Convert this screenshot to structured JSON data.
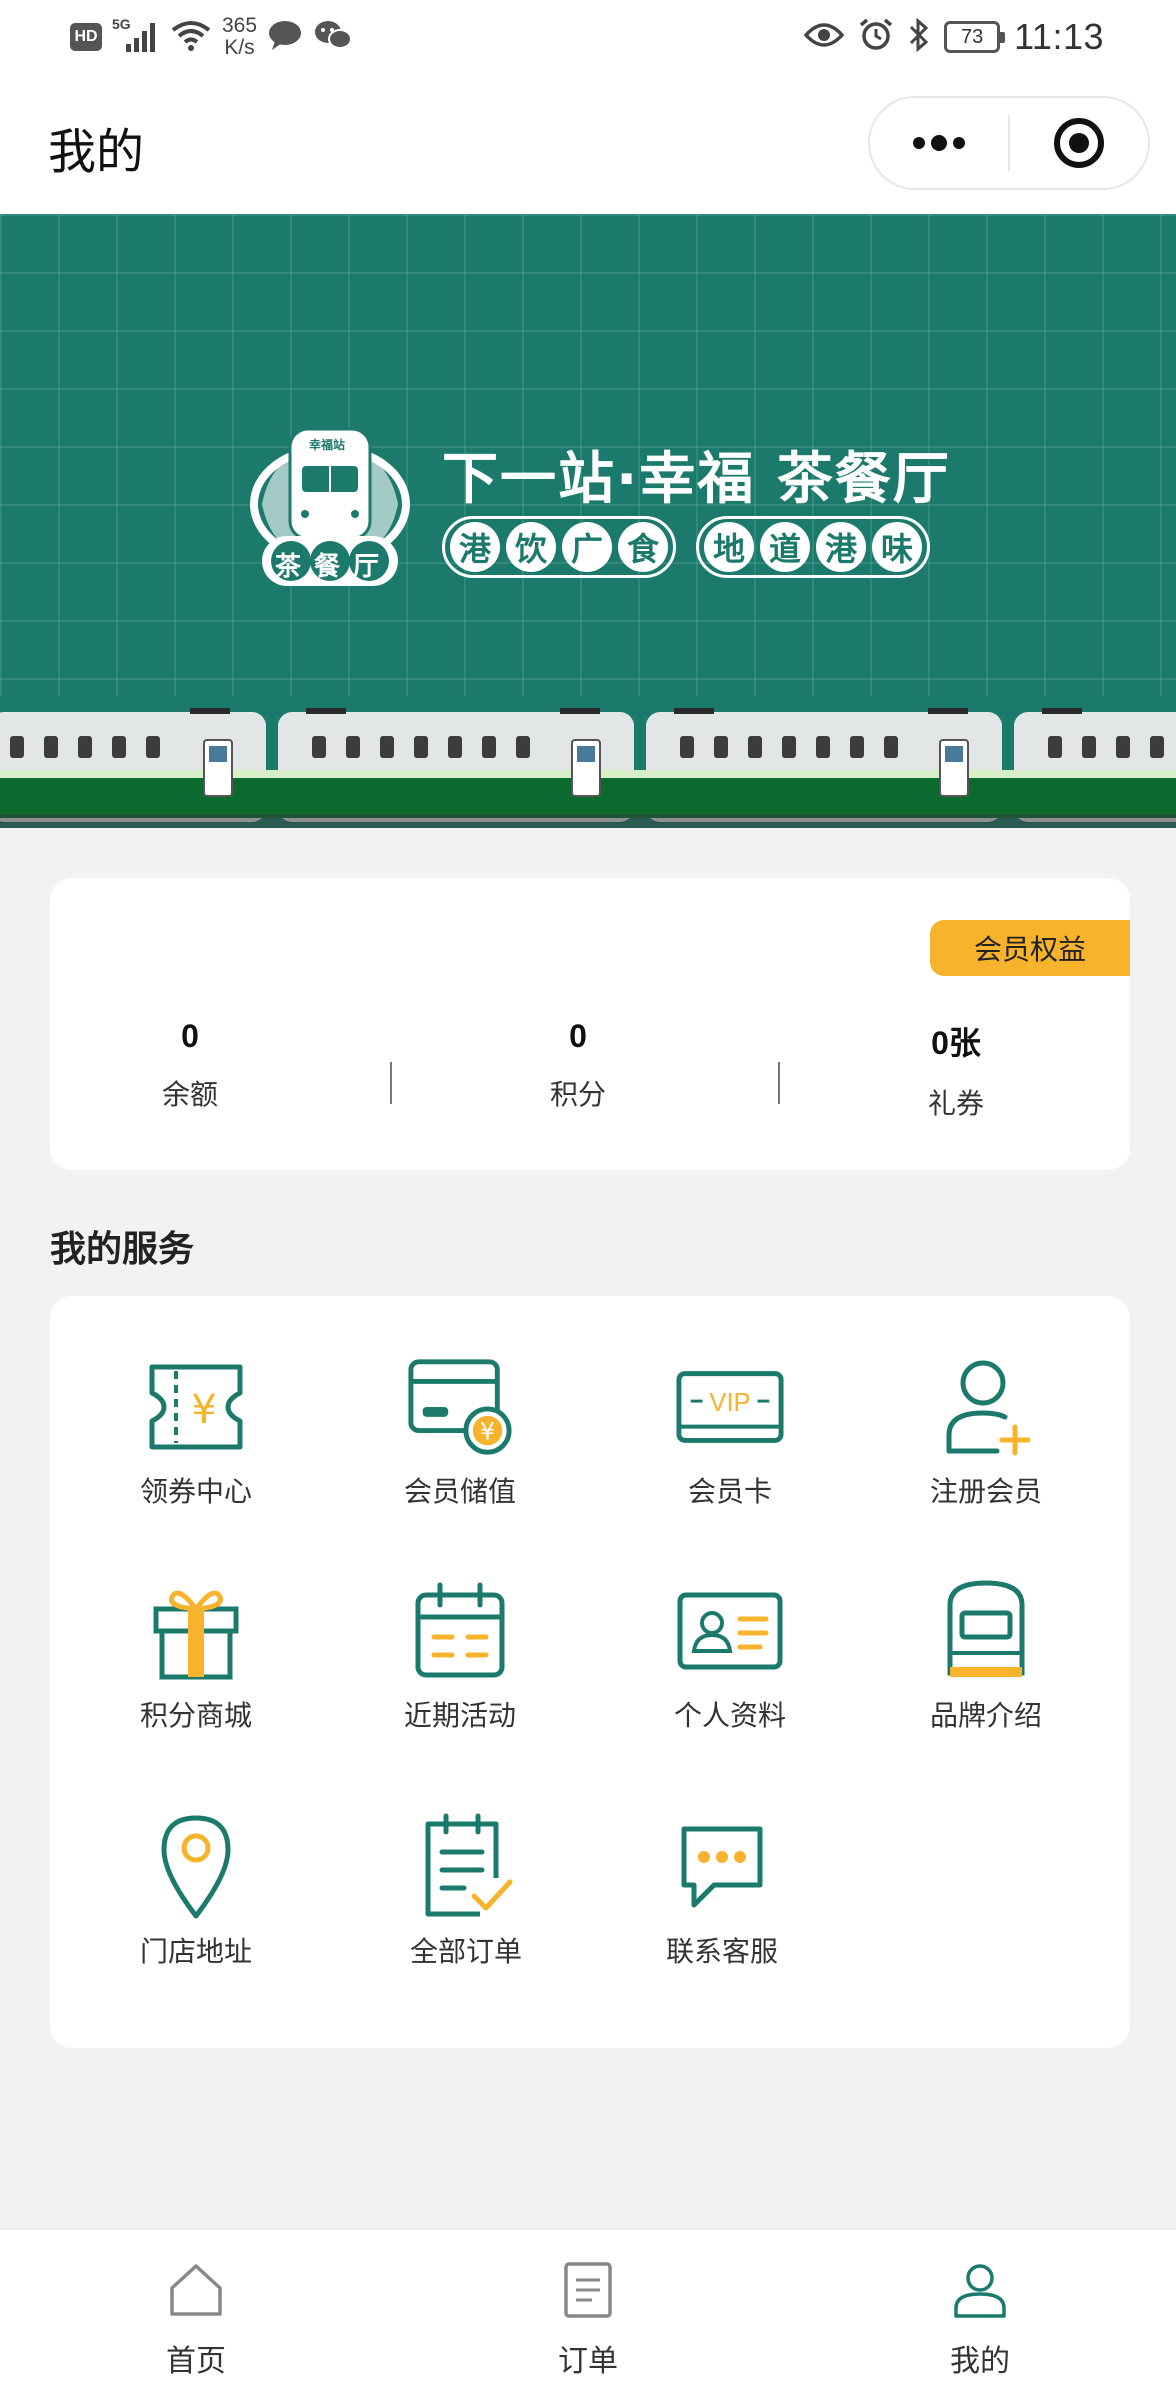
{
  "status_bar": {
    "network_badge": "HD",
    "signal_badge": "5G",
    "net_speed_value": "365",
    "net_speed_unit": "K/s",
    "battery": "73",
    "time": "11:13"
  },
  "header": {
    "title": "我的"
  },
  "banner": {
    "brand_line1": "下一站·幸福 茶餐厅",
    "pill_left": [
      "港",
      "饮",
      "广",
      "食"
    ],
    "pill_right": [
      "地",
      "道",
      "港",
      "味"
    ],
    "logo_sign": "幸福站",
    "logo_chars": [
      "茶",
      "餐",
      "厅"
    ]
  },
  "member": {
    "benefit_label": "会员权益",
    "stats": [
      {
        "value": "0",
        "label": "余额"
      },
      {
        "value": "0",
        "label": "积分"
      },
      {
        "value": "0张",
        "label": "礼券"
      }
    ]
  },
  "services": {
    "title": "我的服务",
    "items": [
      {
        "label": "领券中心",
        "icon": "coupon-icon"
      },
      {
        "label": "会员储值",
        "icon": "stored-value-card-icon"
      },
      {
        "label": "会员卡",
        "icon": "vip-card-icon"
      },
      {
        "label": "注册会员",
        "icon": "add-user-icon"
      },
      {
        "label": "积分商城",
        "icon": "gift-icon"
      },
      {
        "label": "近期活动",
        "icon": "calendar-icon"
      },
      {
        "label": "个人资料",
        "icon": "id-card-icon"
      },
      {
        "label": "品牌介绍",
        "icon": "train-icon"
      },
      {
        "label": "门店地址",
        "icon": "location-pin-icon"
      },
      {
        "label": "全部订单",
        "icon": "order-list-icon"
      },
      {
        "label": "联系客服",
        "icon": "chat-icon"
      }
    ],
    "vip_text": "VIP",
    "coupon_symbol": "¥"
  },
  "tabbar": {
    "items": [
      {
        "label": "首页",
        "icon": "home-icon"
      },
      {
        "label": "订单",
        "icon": "order-icon"
      },
      {
        "label": "我的",
        "icon": "user-icon"
      }
    ]
  },
  "colors": {
    "brand_green": "#1b7a6c",
    "accent_yellow": "#f7b32b",
    "train_green": "#0b6b2e"
  }
}
